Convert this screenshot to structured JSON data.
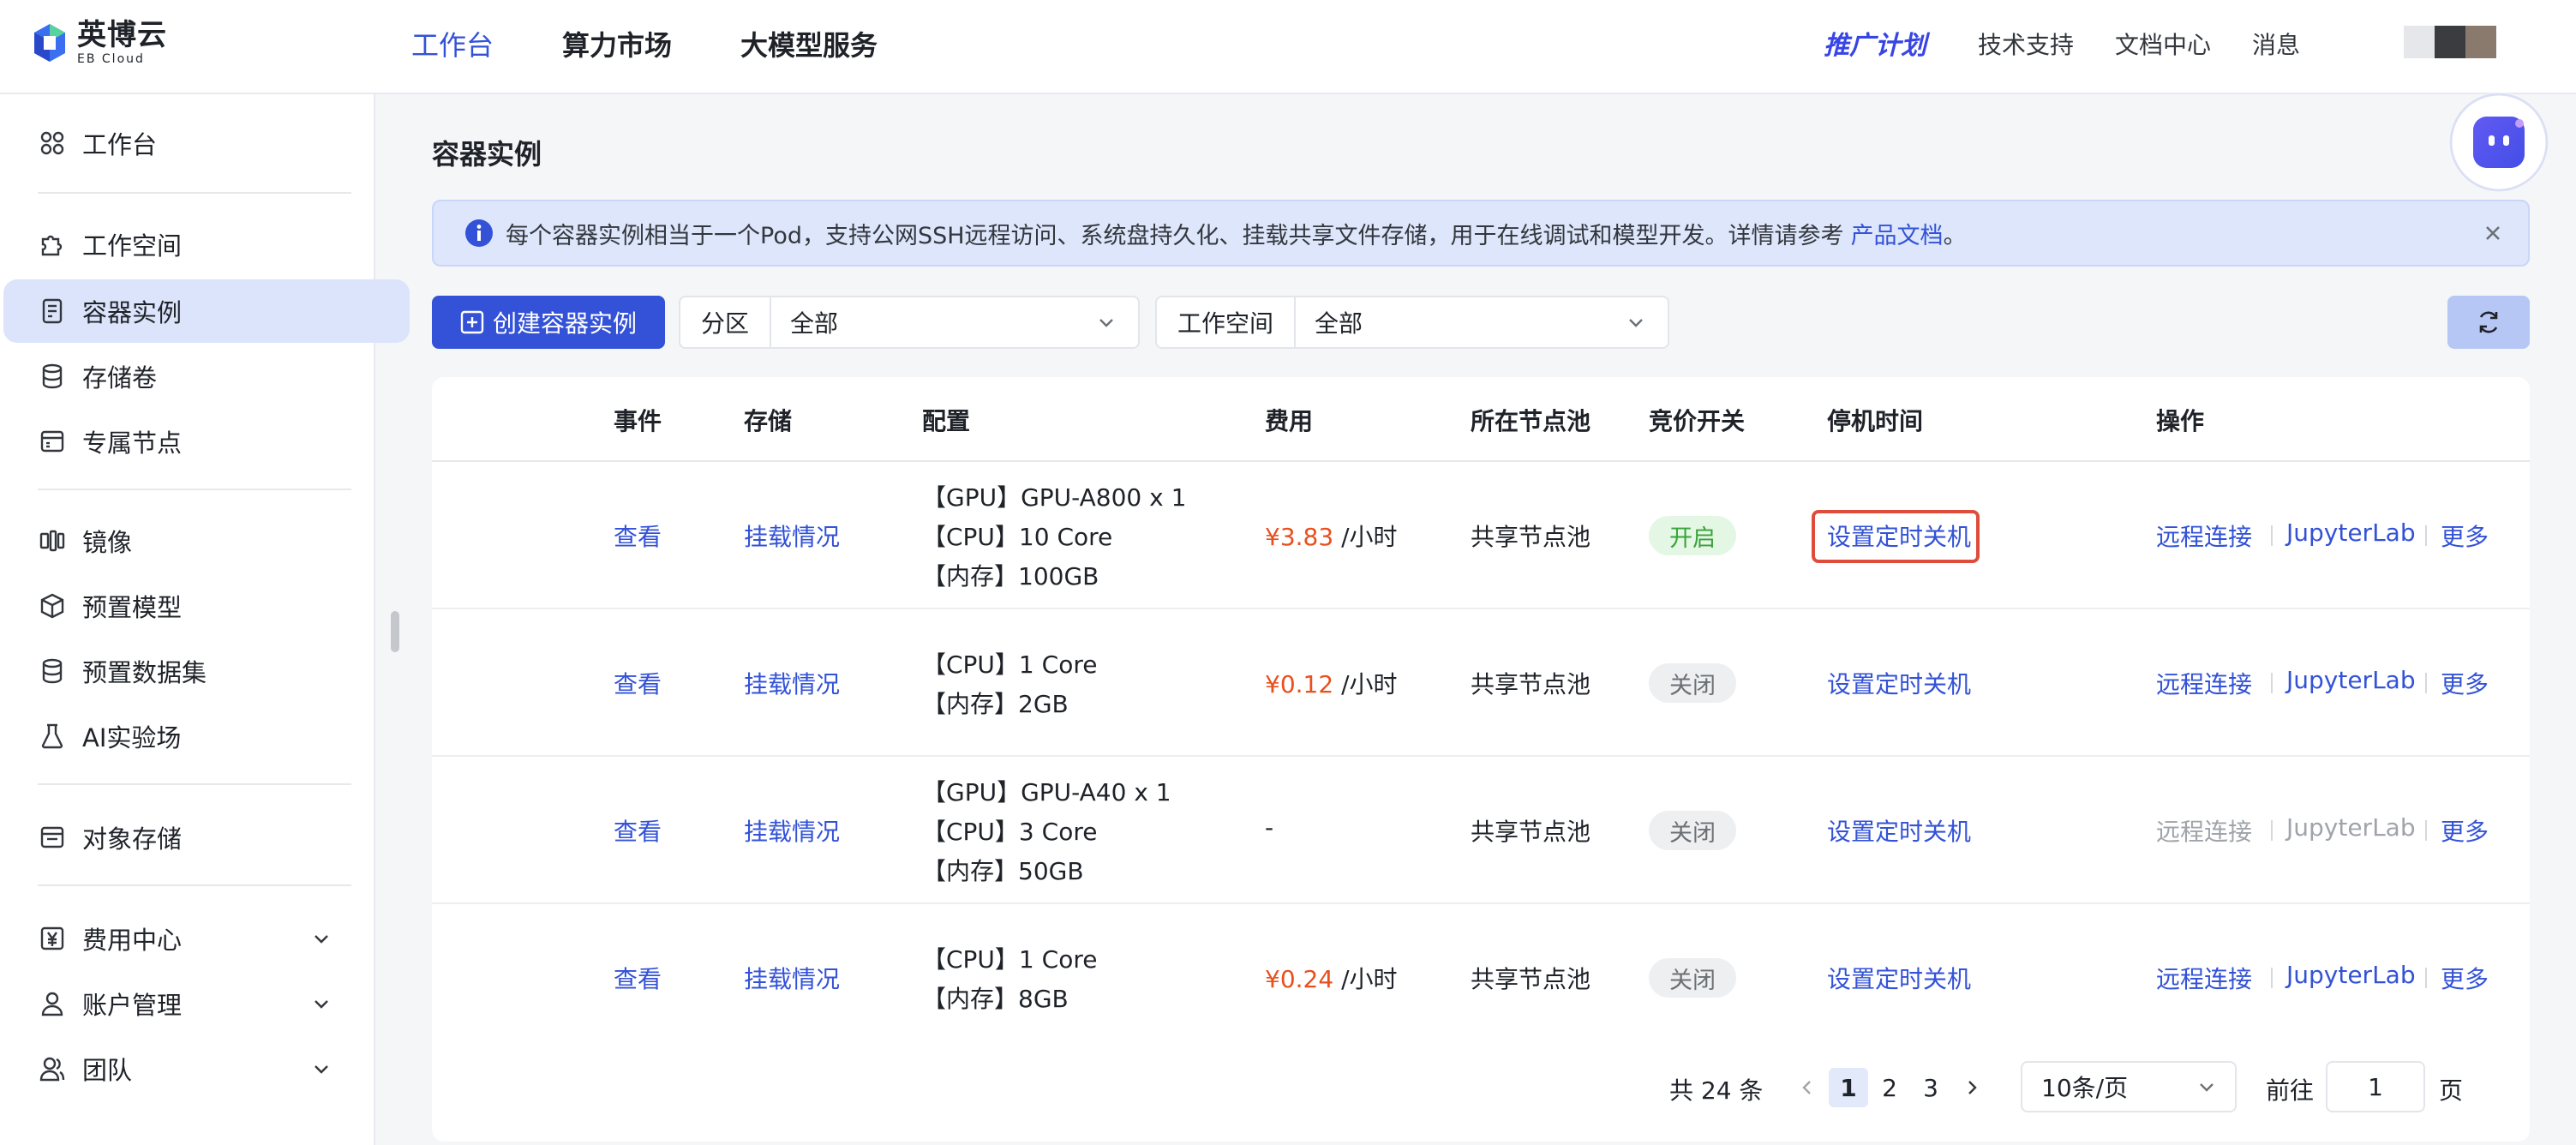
{
  "brand": {
    "name_cn": "英博云",
    "name_en": "EB Cloud"
  },
  "topnav": [
    {
      "label": "工作台",
      "active": true
    },
    {
      "label": "算力市场",
      "active": false
    },
    {
      "label": "大模型服务",
      "active": false
    }
  ],
  "header_right": {
    "promo": "推广计划",
    "support": "技术支持",
    "docs": "文档中心",
    "messages": "消息"
  },
  "sidebar": {
    "items": [
      {
        "label": "工作台",
        "icon": "dashboard-icon"
      },
      {
        "label": "工作空间",
        "icon": "puzzle-icon"
      },
      {
        "label": "容器实例",
        "icon": "container-icon",
        "active": true
      },
      {
        "label": "存储卷",
        "icon": "database-icon"
      },
      {
        "label": "专属节点",
        "icon": "server-icon"
      },
      {
        "label": "镜像",
        "icon": "image-icon"
      },
      {
        "label": "预置模型",
        "icon": "cube-icon"
      },
      {
        "label": "预置数据集",
        "icon": "dataset-icon"
      },
      {
        "label": "AI实验场",
        "icon": "flask-icon"
      },
      {
        "label": "对象存储",
        "icon": "bucket-icon"
      },
      {
        "label": "费用中心",
        "icon": "yuan-icon"
      },
      {
        "label": "账户管理",
        "icon": "user-icon"
      },
      {
        "label": "团队",
        "icon": "team-icon"
      }
    ]
  },
  "page": {
    "title": "容器实例",
    "notice": {
      "text": "每个容器实例相当于一个Pod，支持公网SSH远程访问、系统盘持久化、挂载共享文件存储，用于在线调试和模型开发。详情请参考",
      "link": "产品文档",
      "suffix": "。"
    },
    "create_button": "创建容器实例",
    "filters": [
      {
        "label": "分区",
        "value": "全部"
      },
      {
        "label": "工作空间",
        "value": "全部"
      }
    ]
  },
  "table": {
    "columns": [
      "事件",
      "存储",
      "配置",
      "费用",
      "所在节点池",
      "竞价开关",
      "停机时间",
      "操作"
    ],
    "rows": [
      {
        "event": "查看",
        "storage": "挂载情况",
        "config": [
          "【GPU】GPU-A800 x 1",
          "【CPU】10 Core",
          "【内存】100GB"
        ],
        "price": "¥3.83",
        "price_unit": "/小时",
        "pool": "共享节点池",
        "bid": "开启",
        "bid_on": true,
        "shutdown": "设置定时关机",
        "highlighted": true,
        "ops": [
          "远程连接",
          "JupyterLab",
          "更多"
        ],
        "ops_disabled": false
      },
      {
        "event": "查看",
        "storage": "挂载情况",
        "config": [
          "【CPU】1 Core",
          "【内存】2GB"
        ],
        "price": "¥0.12",
        "price_unit": "/小时",
        "pool": "共享节点池",
        "bid": "关闭",
        "bid_on": false,
        "shutdown": "设置定时关机",
        "highlighted": false,
        "ops": [
          "远程连接",
          "JupyterLab",
          "更多"
        ],
        "ops_disabled": false
      },
      {
        "event": "查看",
        "storage": "挂载情况",
        "config": [
          "【GPU】GPU-A40 x 1",
          "【CPU】3 Core",
          "【内存】50GB"
        ],
        "price": "-",
        "price_unit": "",
        "pool": "共享节点池",
        "bid": "关闭",
        "bid_on": false,
        "shutdown": "设置定时关机",
        "highlighted": false,
        "ops": [
          "远程连接",
          "JupyterLab",
          "更多"
        ],
        "ops_disabled": true
      },
      {
        "event": "查看",
        "storage": "挂载情况",
        "config": [
          "【CPU】1 Core",
          "【内存】8GB"
        ],
        "price": "¥0.24",
        "price_unit": "/小时",
        "pool": "共享节点池",
        "bid": "关闭",
        "bid_on": false,
        "shutdown": "设置定时关机",
        "highlighted": false,
        "ops": [
          "远程连接",
          "JupyterLab",
          "更多"
        ],
        "ops_disabled": false
      }
    ]
  },
  "pagination": {
    "total": "共 24 条",
    "pages": [
      "1",
      "2",
      "3"
    ],
    "current": "1",
    "page_size": "10条/页",
    "goto_prefix": "前往",
    "goto_value": "1",
    "goto_suffix": "页"
  },
  "colors": {
    "primary": "#3352d7",
    "price": "#e8501e",
    "highlight_border": "#e04c3c"
  }
}
